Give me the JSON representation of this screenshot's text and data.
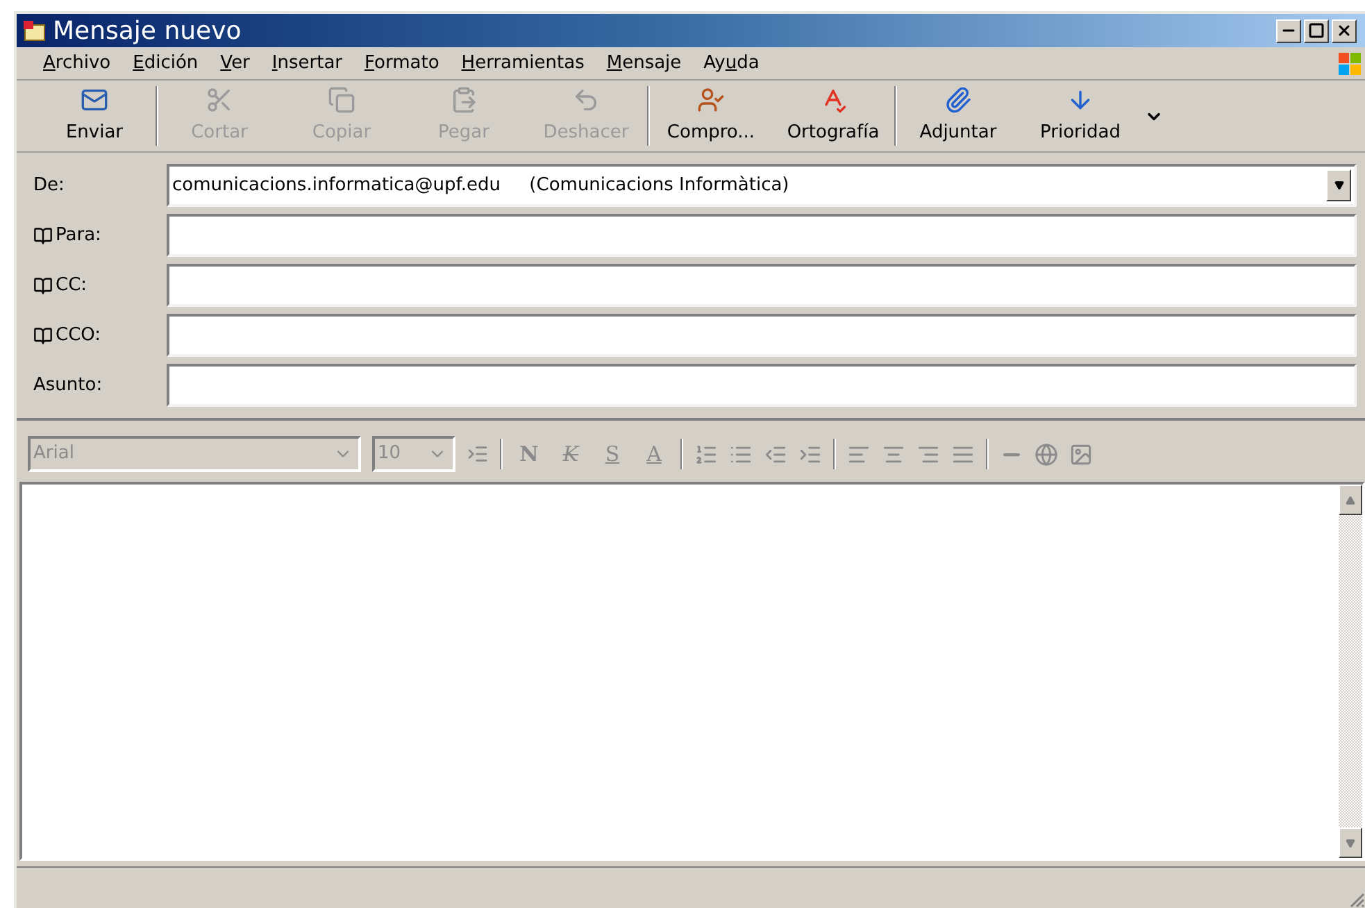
{
  "window": {
    "title": "Mensaje nuevo"
  },
  "menu": [
    {
      "key": "A",
      "after": "rchivo"
    },
    {
      "key": "E",
      "after": "dición"
    },
    {
      "key": "V",
      "after": "er"
    },
    {
      "key": "I",
      "after": "nsertar"
    },
    {
      "key": "F",
      "after": "ormato"
    },
    {
      "key": "H",
      "after": "erramientas"
    },
    {
      "key": "M",
      "after": "ensaje"
    },
    {
      "before": "Ay",
      "key": "u",
      "after": "da"
    }
  ],
  "toolbar": [
    {
      "label": "Enviar",
      "disabled": false
    },
    {
      "label": "Cortar",
      "disabled": true
    },
    {
      "label": "Copiar",
      "disabled": true
    },
    {
      "label": "Pegar",
      "disabled": true
    },
    {
      "label": "Deshacer",
      "disabled": true
    },
    {
      "label": "Compro...",
      "disabled": false
    },
    {
      "label": "Ortografía",
      "disabled": false
    },
    {
      "label": "Adjuntar",
      "disabled": false
    },
    {
      "label": "Prioridad",
      "disabled": false
    }
  ],
  "fields": [
    {
      "kind": "select",
      "label": "De:",
      "value": "comunicacions.informatica@upf.edu     (Comunicacions Informàtica)"
    },
    {
      "kind": "address",
      "label": "Para:"
    },
    {
      "kind": "address",
      "label": "CC:"
    },
    {
      "kind": "address",
      "label": "CCO:"
    },
    {
      "kind": "text",
      "label": "Asunto:"
    }
  ],
  "format_bar": {
    "disabled": true,
    "font": "Arial",
    "size": "10",
    "letters": [
      "N",
      "K",
      "S",
      "A"
    ]
  }
}
